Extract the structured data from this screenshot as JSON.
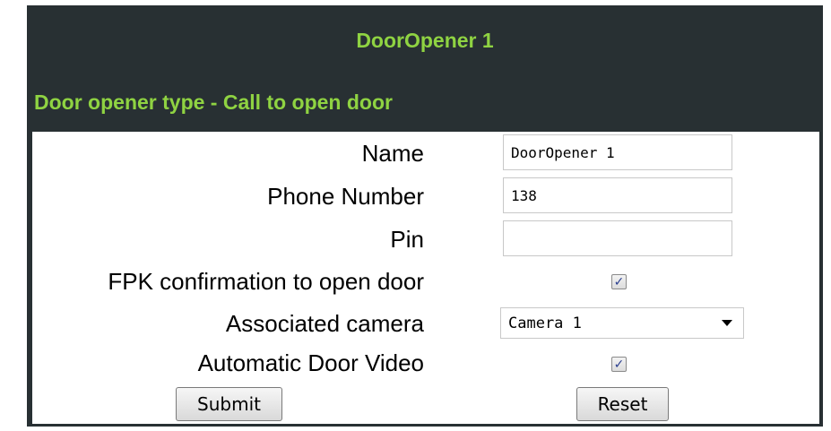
{
  "header": {
    "title": "DoorOpener 1",
    "subtitle": "Door opener type - Call to open door"
  },
  "form": {
    "name": {
      "label": "Name",
      "value": "DoorOpener 1"
    },
    "phone_number": {
      "label": "Phone Number",
      "value": "138"
    },
    "pin": {
      "label": "Pin",
      "value": ""
    },
    "fpk_confirmation": {
      "label": "FPK confirmation to open door",
      "checked": true
    },
    "associated_camera": {
      "label": "Associated camera",
      "value": "Camera 1"
    },
    "automatic_door_video": {
      "label": "Automatic Door Video",
      "checked": true
    },
    "check_glyph": "✓"
  },
  "buttons": {
    "submit": "Submit",
    "reset": "Reset"
  },
  "colors": {
    "panel_background": "#283033",
    "heading_green": "#8fd342",
    "check_color": "#2b3f8f"
  }
}
